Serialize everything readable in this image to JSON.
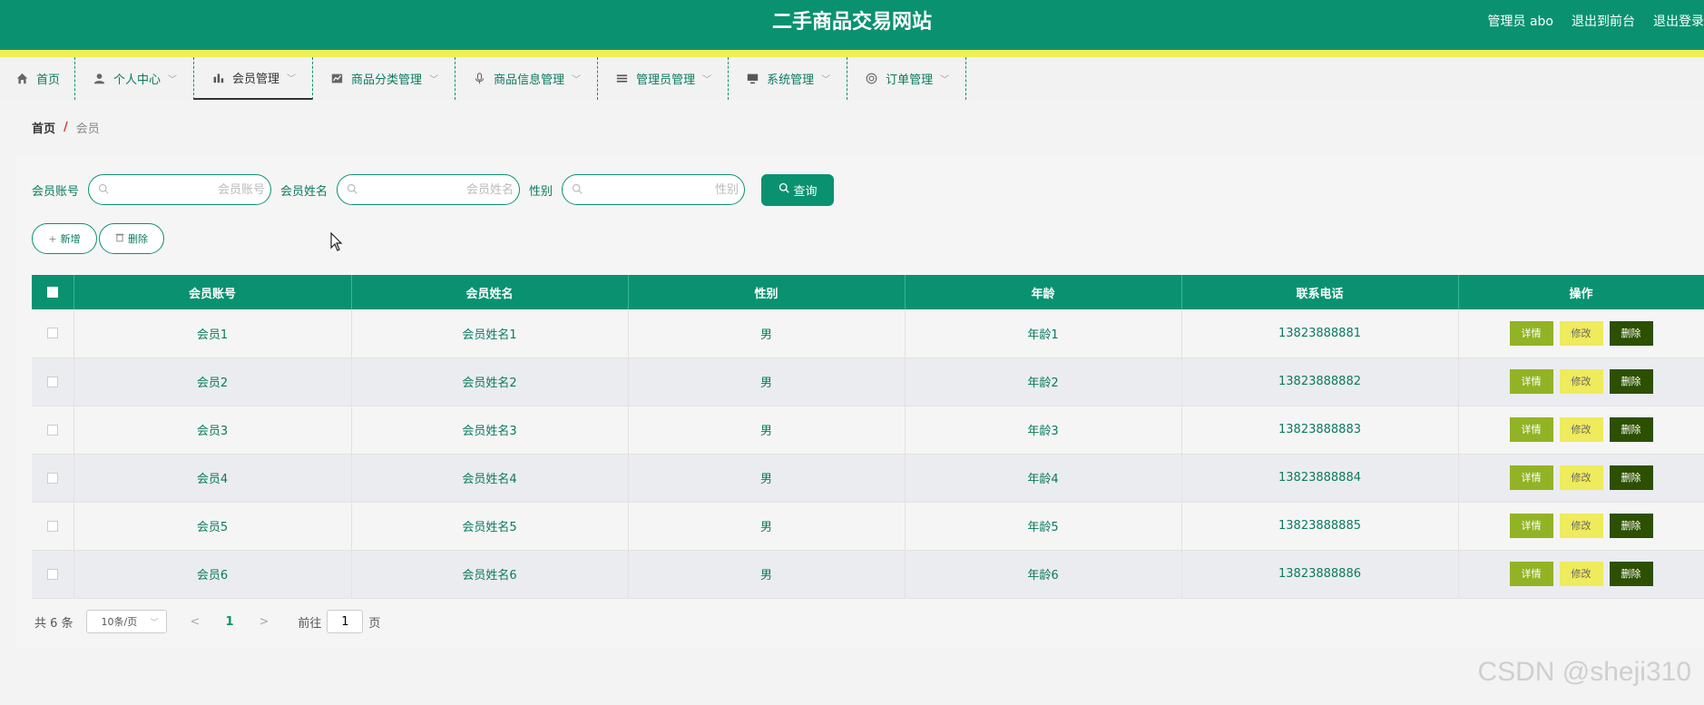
{
  "header": {
    "title": "二手商品交易网站",
    "user": "管理员 abo",
    "to_front": "退出到前台",
    "logout": "退出登录"
  },
  "nav": {
    "items": [
      {
        "label": "首页",
        "icon": "home-icon"
      },
      {
        "label": "个人中心",
        "icon": "user-icon"
      },
      {
        "label": "会员管理",
        "icon": "bar-chart-icon"
      },
      {
        "label": "商品分类管理",
        "icon": "chart-icon"
      },
      {
        "label": "商品信息管理",
        "icon": "mic-icon"
      },
      {
        "label": "管理员管理",
        "icon": "list-icon"
      },
      {
        "label": "系统管理",
        "icon": "monitor-icon"
      },
      {
        "label": "订单管理",
        "icon": "circle-icon"
      }
    ]
  },
  "breadcrumb": {
    "home": "首页",
    "sep": "/",
    "current": "会员"
  },
  "search": {
    "account_label": "会员账号",
    "account_placeholder": "会员账号",
    "name_label": "会员姓名",
    "name_placeholder": "会员姓名",
    "gender_label": "性别",
    "gender_placeholder": "性别",
    "query_label": "查询"
  },
  "actions": {
    "add_label": "新增",
    "delete_label": "删除"
  },
  "table": {
    "headers": [
      "会员账号",
      "会员姓名",
      "性别",
      "年龄",
      "联系电话",
      "操作"
    ],
    "rows": [
      [
        "会员1",
        "会员姓名1",
        "男",
        "年龄1",
        "13823888881"
      ],
      [
        "会员2",
        "会员姓名2",
        "男",
        "年龄2",
        "13823888882"
      ],
      [
        "会员3",
        "会员姓名3",
        "男",
        "年龄3",
        "13823888883"
      ],
      [
        "会员4",
        "会员姓名4",
        "男",
        "年龄4",
        "13823888884"
      ],
      [
        "会员5",
        "会员姓名5",
        "男",
        "年龄5",
        "13823888885"
      ],
      [
        "会员6",
        "会员姓名6",
        "男",
        "年龄6",
        "13823888886"
      ]
    ],
    "op_detail": "详情",
    "op_edit": "修改",
    "op_delete": "删除"
  },
  "pager": {
    "total": "共 6 条",
    "page_size": "10条/页",
    "current_page": "1",
    "goto_prefix": "前往",
    "goto_value": "1",
    "goto_suffix": "页"
  },
  "watermark": "CSDN @sheji310",
  "colors": {
    "primary": "#0a9270",
    "accent_yellow": "#eeef57",
    "detail": "#92b325",
    "edit": "#eeeb5d",
    "delete": "#2c5000"
  }
}
